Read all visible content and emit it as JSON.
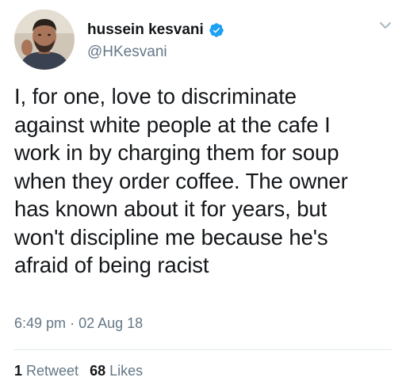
{
  "author": {
    "display_name": "hussein kesvani",
    "handle": "@HKesvani",
    "verified": true
  },
  "tweet": {
    "lines": [
      "I, for one, love to discriminate",
      "against white people at the cafe I",
      "work in by charging them for soup",
      "when they order coffee. The owner",
      "has known about it for years, but",
      "won't discipline me because he's",
      "afraid of being racist"
    ],
    "time": "6:49 pm",
    "separator": "·",
    "date": "02 Aug 18"
  },
  "stats": {
    "retweets_count": "1",
    "retweets_label": "Retweet",
    "likes_count": "68",
    "likes_label": "Likes"
  },
  "colors": {
    "verified_badge": "#1da1f2",
    "secondary_text": "#657786",
    "primary_text": "#14171a",
    "divider": "#e1e8ed"
  },
  "icons": {
    "verified": "verified-badge-icon",
    "menu": "chevron-down-icon"
  }
}
